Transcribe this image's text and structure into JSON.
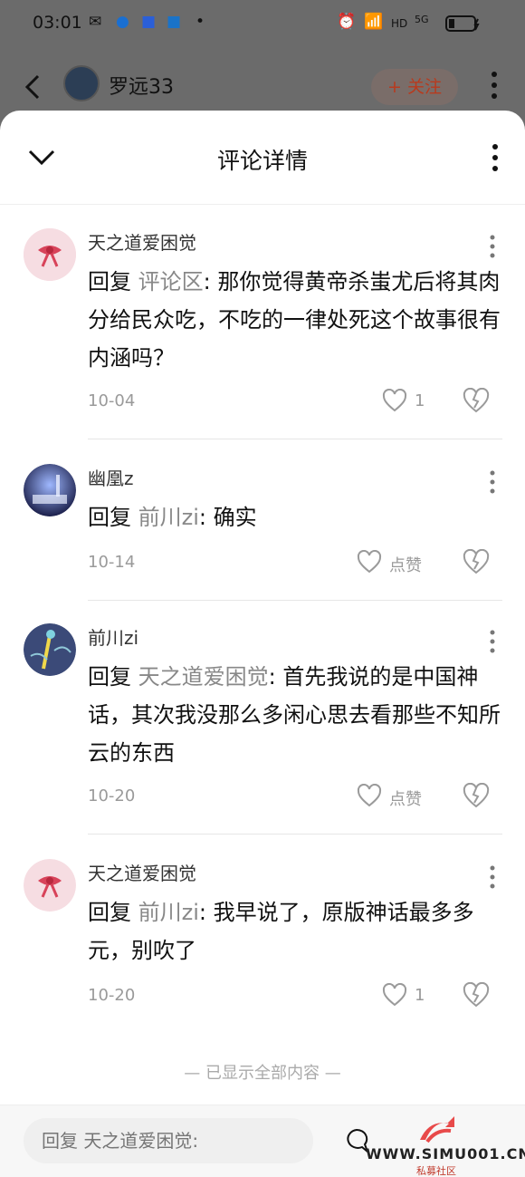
{
  "status_bar": {
    "time": "03:01",
    "hd": "HD",
    "signal": "5G"
  },
  "background_header": {
    "title": "罗远33",
    "follow_label": "+ 关注"
  },
  "sheet": {
    "title": "评论详情"
  },
  "comments": [
    {
      "author": "天之道爱困觉",
      "reply_prefix": "回复 ",
      "reply_to": "评论区",
      "text": ": 那你觉得黄帝杀蚩尤后将其肉分给民众吃，不吃的一律处死这个故事很有内涵吗？",
      "date": "10-04",
      "likes": "1"
    },
    {
      "author": "幽凰z",
      "reply_prefix": "回复 ",
      "reply_to": "前川zi",
      "text": ": 确实",
      "date": "10-14",
      "likes": "点赞"
    },
    {
      "author": "前川zi",
      "reply_prefix": "回复 ",
      "reply_to": "天之道爱困觉",
      "text": ": 首先我说的是中国神话，其次我没那么多闲心思去看那些不知所云的东西",
      "date": "10-20",
      "likes": "点赞"
    },
    {
      "author": "天之道爱困觉",
      "reply_prefix": "回复 ",
      "reply_to": "前川zi",
      "text": ": 我早说了，原版神话最多多元，别吹了",
      "date": "10-20",
      "likes": "1"
    }
  ],
  "end_note": "— 已显示全部内容 —",
  "reply_bar": {
    "placeholder": "回复 天之道爱困觉:"
  },
  "watermark": {
    "text": "WWW.SIMU001.CN",
    "sub": "私募社区"
  }
}
